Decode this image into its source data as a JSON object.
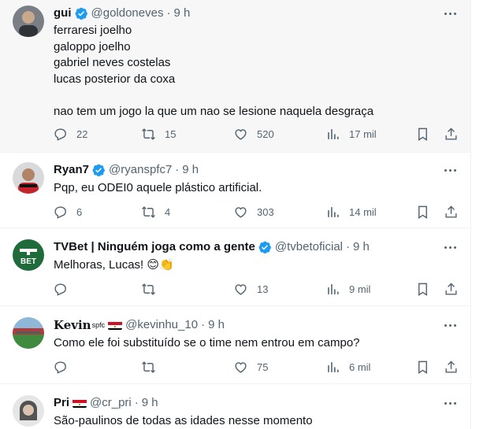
{
  "tweets": [
    {
      "name": "gui",
      "handle": "@goldoneves",
      "time": "9 h",
      "text": "ferraresi joelho\ngaloppo joelho\ngabriel neves costelas\nlucas posterior da coxa\n\nnao tem um jogo la que um nao se lesione naquela desgraça",
      "replies": "22",
      "retweets": "15",
      "likes": "520",
      "views": "17 mil"
    },
    {
      "name": "Ryan7",
      "handle": "@ryanspfc7",
      "time": "9 h",
      "text": "Pqp, eu ODEI0 aquele plástico artificial.",
      "replies": "6",
      "retweets": "4",
      "likes": "303",
      "views": "14 mil"
    },
    {
      "name": "TVBet | Ninguém joga como a gente",
      "handle": "@tvbetoficial",
      "time": "9 h",
      "text": "Melhoras, Lucas! 😊👏",
      "replies": "",
      "retweets": "",
      "likes": "13",
      "views": "9 mil",
      "avatar_text": "BET"
    },
    {
      "name": "Kevin",
      "name_sup": "spfc",
      "handle": "@kevinhu_10",
      "time": "9 h",
      "text": "Como ele foi substituído se o time nem entrou em campo?",
      "replies": "",
      "retweets": "",
      "likes": "75",
      "views": "6 mil"
    },
    {
      "name": "Pri",
      "handle": "@cr_pri",
      "time": "9 h",
      "text": "São-paulinos de todas as idades nesse momento"
    }
  ],
  "separator": "·",
  "colors": {
    "verified": "#1d9bf0",
    "secondary_text": "#536471",
    "tvbet_green": "#1f6b3a"
  }
}
